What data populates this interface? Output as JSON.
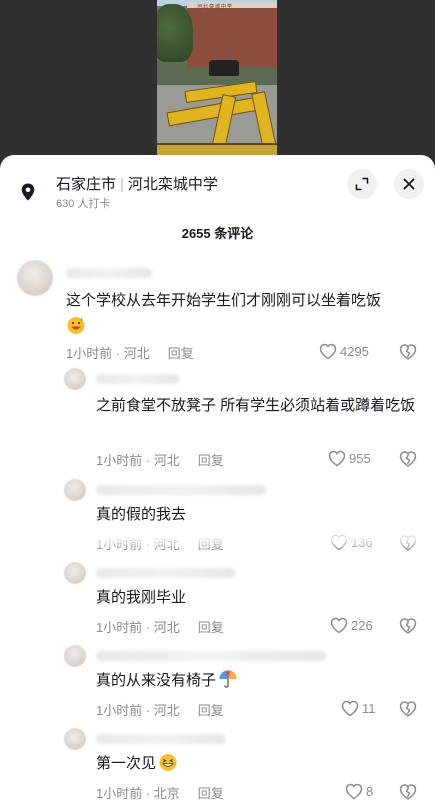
{
  "location": {
    "city": "石家庄市",
    "name": "河北栾城中学",
    "checkins": "630 人打卡"
  },
  "comment_count": "2655 条评论",
  "comments": [
    {
      "text": "这个学校从去年开始学生们才刚刚可以坐着吃饭",
      "time_region": "1小时前 · 河北",
      "reply_label": "回复",
      "likes": "4295",
      "emoji": "grinning-sweat-emoji"
    },
    {
      "text": "之前食堂不放凳子 所有学生必须站着或蹲着吃饭",
      "time_region": "1小时前 · 河北",
      "reply_label": "回复",
      "likes": "955"
    },
    {
      "text": "真的假的我去",
      "time_region": "1小时前 · 河北",
      "reply_label": "回复",
      "likes": "136"
    },
    {
      "text": "真的我刚毕业",
      "time_region": "1小时前 · 河北",
      "reply_label": "回复",
      "likes": "226"
    },
    {
      "text": "真的从来没有椅子",
      "time_region": "1小时前 · 河北",
      "reply_label": "回复",
      "likes": "11",
      "emoji": "umbrella-emoji"
    },
    {
      "text": "第一次见",
      "time_region": "1小时前 · 北京",
      "reply_label": "回复",
      "likes": "8",
      "emoji": "laughing-emoji"
    }
  ],
  "colors": {
    "text_primary": "#161823",
    "text_secondary": "#8a8b91",
    "sheet_bg": "#ffffff",
    "button_bg": "#f1f1f2"
  }
}
